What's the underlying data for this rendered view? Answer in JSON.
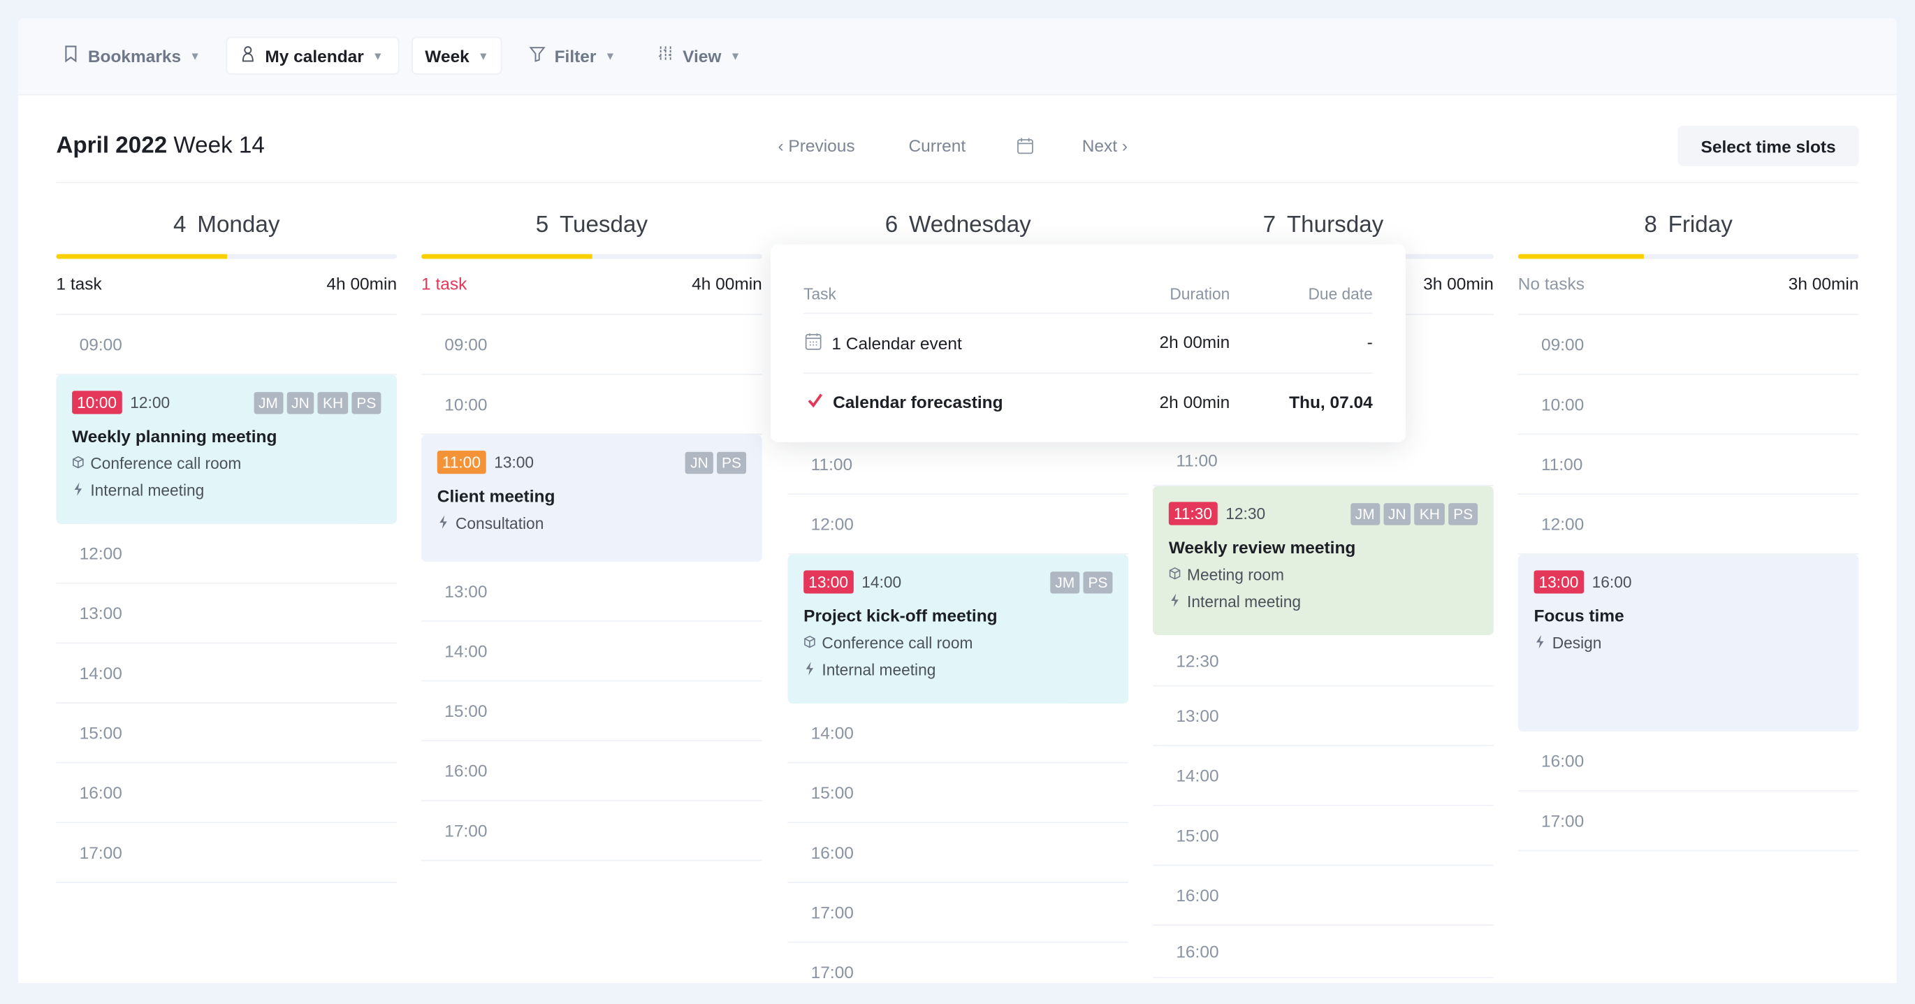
{
  "colors": {
    "accent_red": "#e5375a",
    "accent_orange": "#f39237",
    "progress": "#f9d100",
    "event_cyan": "#e2f5f8",
    "event_lavender": "#eef2fa",
    "event_green": "#e3f0df",
    "avatar": "#aeb7c2"
  },
  "toolbar": {
    "bookmarks": {
      "label": "Bookmarks",
      "icon": "bookmark-icon"
    },
    "my_calendar": {
      "label": "My calendar",
      "icon": "user-icon"
    },
    "week": {
      "label": "Week"
    },
    "filter": {
      "label": "Filter",
      "icon": "filter-icon"
    },
    "view": {
      "label": "View",
      "icon": "sliders-icon"
    }
  },
  "header": {
    "month_year": "April 2022",
    "week": "Week 14",
    "previous": "‹  Previous",
    "current": "Current",
    "next": "Next  ›",
    "select_slots": "Select time slots"
  },
  "days": [
    {
      "num": "4",
      "name": "Monday",
      "tasks": "1 task",
      "tasks_style": "normal",
      "duration": "4h 00min",
      "progress": 0.5,
      "items": [
        {
          "t": "row",
          "label": "09:00"
        },
        {
          "t": "event",
          "start": "10:00",
          "end": "12:00",
          "start_color": "red",
          "bg": "cyan",
          "avatars": [
            "JM",
            "JN",
            "KH",
            "PS"
          ],
          "title": "Weekly planning meeting",
          "location": "Conference call room",
          "category": "Internal meeting"
        },
        {
          "t": "row",
          "label": "12:00"
        },
        {
          "t": "row",
          "label": "13:00"
        },
        {
          "t": "row",
          "label": "14:00"
        },
        {
          "t": "row",
          "label": "15:00"
        },
        {
          "t": "row",
          "label": "16:00"
        },
        {
          "t": "row",
          "label": "17:00"
        }
      ]
    },
    {
      "num": "5",
      "name": "Tuesday",
      "tasks": "1 task",
      "tasks_style": "red",
      "duration": "4h 00min",
      "progress": 0.5,
      "items": [
        {
          "t": "row",
          "label": "09:00"
        },
        {
          "t": "row",
          "label": "10:00"
        },
        {
          "t": "event",
          "start": "11:00",
          "end": "13:00",
          "start_color": "orange",
          "bg": "lavender",
          "avatars": [
            "JN",
            "PS"
          ],
          "title": "Client meeting",
          "category": "Consultation"
        },
        {
          "t": "row",
          "label": "13:00"
        },
        {
          "t": "row",
          "label": "14:00"
        },
        {
          "t": "row",
          "label": "15:00"
        },
        {
          "t": "row",
          "label": "16:00"
        },
        {
          "t": "row",
          "label": "17:00"
        }
      ]
    },
    {
      "num": "6",
      "name": "Wednesday",
      "items": [
        {
          "t": "spacer"
        },
        {
          "t": "row",
          "label": "11:00"
        },
        {
          "t": "row",
          "label": "12:00"
        },
        {
          "t": "event",
          "start": "13:00",
          "end": "14:00",
          "start_color": "red",
          "bg": "cyan",
          "avatars": [
            "JM",
            "PS"
          ],
          "title": "Project kick-off meeting",
          "location": "Conference call room",
          "category": "Internal meeting"
        },
        {
          "t": "row",
          "label": "14:00"
        },
        {
          "t": "row",
          "label": "15:00"
        },
        {
          "t": "row",
          "label": "16:00"
        },
        {
          "t": "row",
          "label": "17:00"
        },
        {
          "t": "row",
          "label": "17:00"
        }
      ]
    },
    {
      "num": "7",
      "name": "Thursday",
      "duration": "3h 00min",
      "items": [
        {
          "t": "spacer"
        },
        {
          "t": "row",
          "label": "11:00"
        },
        {
          "t": "event",
          "start": "11:30",
          "end": "12:30",
          "start_color": "red",
          "bg": "green",
          "avatars": [
            "JM",
            "JN",
            "KH",
            "PS"
          ],
          "title": "Weekly review meeting",
          "location": "Meeting room",
          "category": "Internal meeting"
        },
        {
          "t": "row",
          "label": "12:30"
        },
        {
          "t": "row",
          "label": "13:00"
        },
        {
          "t": "row",
          "label": "14:00"
        },
        {
          "t": "row",
          "label": "15:00"
        },
        {
          "t": "row",
          "label": "16:00"
        },
        {
          "t": "row",
          "label": "16:00"
        }
      ]
    },
    {
      "num": "8",
      "name": "Friday",
      "tasks": "No tasks",
      "tasks_style": "muted",
      "duration": "3h 00min",
      "progress": 0.37,
      "items": [
        {
          "t": "row",
          "label": "09:00"
        },
        {
          "t": "row",
          "label": "10:00"
        },
        {
          "t": "row",
          "label": "11:00"
        },
        {
          "t": "row",
          "label": "12:00"
        },
        {
          "t": "event",
          "start": "13:00",
          "end": "16:00",
          "start_color": "red",
          "bg": "lavender",
          "avatars": [],
          "title": "Focus time",
          "category": "Design"
        },
        {
          "t": "row",
          "label": "16:00"
        },
        {
          "t": "row",
          "label": "17:00"
        }
      ]
    }
  ],
  "popup": {
    "columns": {
      "task": "Task",
      "duration": "Duration",
      "due": "Due date"
    },
    "rows": [
      {
        "icon": "calendar-icon",
        "task": "1 Calendar event",
        "duration": "2h 00min",
        "due": "-"
      },
      {
        "icon": "check-icon",
        "task": "Calendar forecasting",
        "duration": "2h 00min",
        "due": "Thu, 07.04"
      }
    ]
  }
}
